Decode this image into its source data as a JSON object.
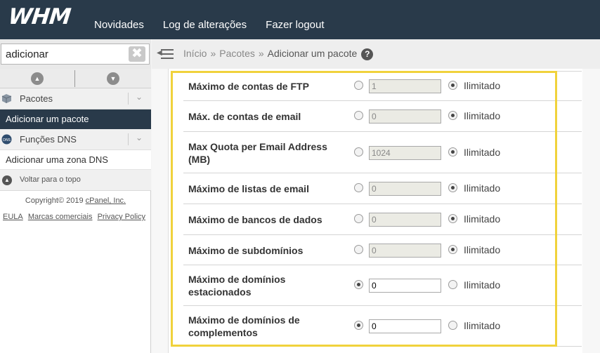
{
  "app": {
    "logo": "WHM"
  },
  "topnav": {
    "items": [
      "Novidades",
      "Log de alterações",
      "Fazer logout"
    ]
  },
  "sidebar": {
    "search": {
      "value": "adicionar",
      "clear_glyph": "✖"
    },
    "scroll_up_glyph": "▲",
    "scroll_down_glyph": "▼",
    "categories": [
      {
        "label": "Pacotes",
        "icon": "packages-icon",
        "items": [
          "Adicionar um pacote"
        ]
      },
      {
        "label": "Funções DNS",
        "icon": "dns-icon",
        "icon_text": "DNS",
        "items": [
          "Adicionar uma zona DNS"
        ]
      }
    ],
    "chevron_glyph": "⌄",
    "back_to_top": "Voltar para o topo",
    "back_to_top_glyph": "▲",
    "copyright_prefix": "Copyright© 2019 ",
    "copyright_link": "cPanel, Inc.",
    "footer_links": [
      "EULA",
      "Marcas comerciais",
      "Privacy Policy"
    ]
  },
  "breadcrumb": {
    "items": [
      "Início",
      "Pacotes"
    ],
    "separator": "»",
    "current": "Adicionar um pacote",
    "help_glyph": "?"
  },
  "form": {
    "unlimited_label": "Ilimitado",
    "rows": [
      {
        "label": "Máximo de contas de FTP",
        "value": "1",
        "mode": "unlimited"
      },
      {
        "label": "Máx. de contas de email",
        "value": "0",
        "mode": "unlimited"
      },
      {
        "label": "Max Quota per Email Address (MB)",
        "value": "1024",
        "mode": "unlimited"
      },
      {
        "label": "Máximo de listas de email",
        "value": "0",
        "mode": "unlimited"
      },
      {
        "label": "Máximo de bancos de dados",
        "value": "0",
        "mode": "unlimited"
      },
      {
        "label": "Máximo de subdomínios",
        "value": "0",
        "mode": "unlimited"
      },
      {
        "label": "Máximo de domínios estacionados",
        "value": "0",
        "mode": "limited"
      },
      {
        "label": "Máximo de domínios de complementos",
        "value": "0",
        "mode": "limited"
      }
    ]
  },
  "colors": {
    "topbar": "#293a4a",
    "active_item": "#293a4a",
    "highlight_border": "#f0d23c"
  }
}
